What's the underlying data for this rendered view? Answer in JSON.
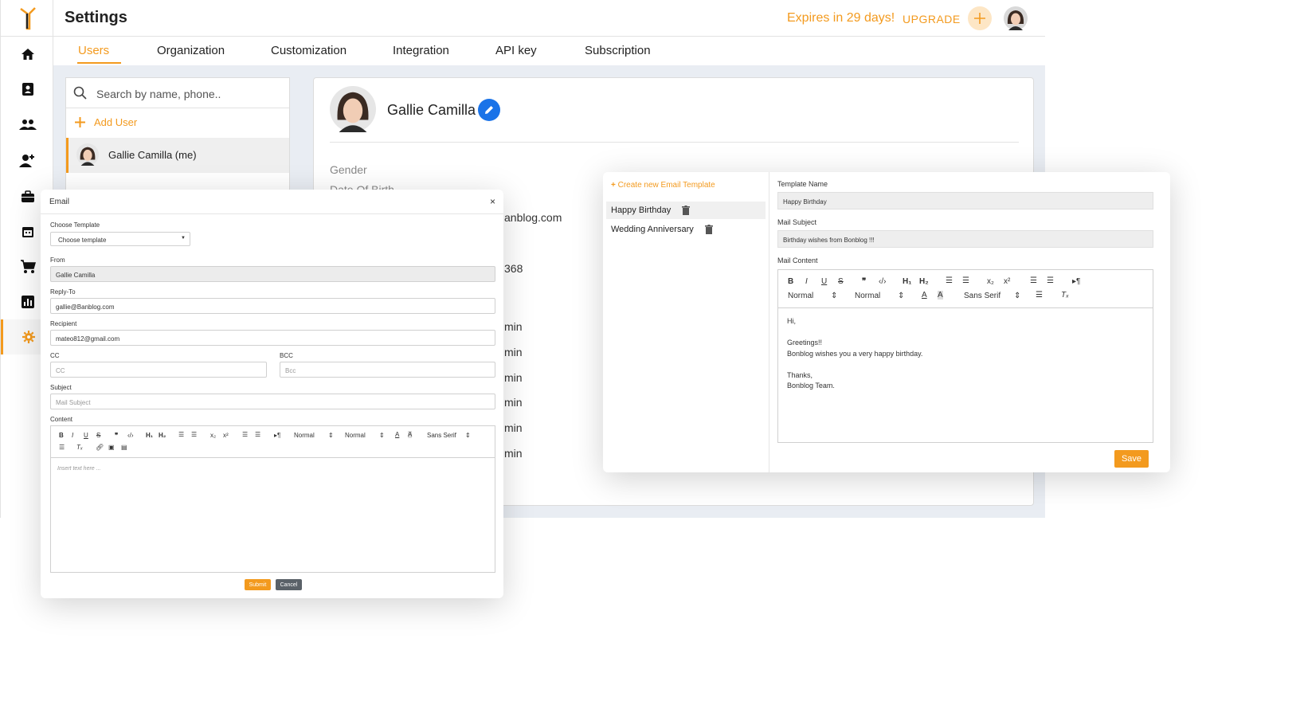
{
  "app": {
    "title": "Settings",
    "expires": "Expires in 29 days!",
    "upgrade": "UPGRADE",
    "accent_color": "#f39a1e",
    "tabs": [
      "Users",
      "Organization",
      "Customization",
      "Integration",
      "API key",
      "Subscription"
    ],
    "active_tab": "Users",
    "sidebar_icons": [
      "home-icon",
      "contacts-icon",
      "users-icon",
      "add-user-icon",
      "briefcase-icon",
      "calendar-icon",
      "cart-icon",
      "chart-icon",
      "gear-icon"
    ]
  },
  "users": {
    "search_placeholder": "Search by name, phone..",
    "add_user": "Add User",
    "list": [
      {
        "name": "Gallie Camilla (me)"
      }
    ]
  },
  "profile": {
    "name": "Gallie Camilla",
    "labels": {
      "gender": "Gender",
      "dob": "Date Of Birth"
    },
    "visible_fragments": {
      "email_tail": "anblog.com",
      "phone_tail": "368",
      "min": "min"
    }
  },
  "email_modal": {
    "title": "Email",
    "close": "×",
    "choose_template_label": "Choose Template",
    "choose_template_value": "Choose template",
    "from_label": "From",
    "from_value": "Gallie Camilla",
    "reply_to_label": "Reply-To",
    "reply_to_value": "gallie@Banblog.com",
    "recipient_label": "Recipient",
    "recipient_value": "mateo812@gmail.com",
    "cc_label": "CC",
    "cc_placeholder": "CC",
    "bcc_label": "BCC",
    "bcc_placeholder": "Bcc",
    "subject_label": "Subject",
    "subject_placeholder": "Mail Subject",
    "content_label": "Content",
    "toolbar": {
      "normal1": "Normal",
      "normal2": "Normal",
      "font": "Sans Serif"
    },
    "content_placeholder": "Insert text here ...",
    "submit": "Submit",
    "cancel": "Cancel"
  },
  "template_panel": {
    "create": "Create new Email Template",
    "templates": [
      "Happy Birthday",
      "Wedding Anniversary"
    ],
    "template_name_label": "Template Name",
    "template_name_value": "Happy Birthday",
    "mail_subject_label": "Mail Subject",
    "mail_subject_value": "Birthday wishes from Bonblog !!!",
    "mail_content_label": "Mail Content",
    "toolbar": {
      "normal1": "Normal",
      "normal2": "Normal",
      "font": "Sans Serif"
    },
    "body_lines": [
      "Hi,",
      "",
      "Greetings!!",
      "Bonblog wishes you a very happy birthday.",
      "",
      "Thanks,",
      "Bonblog Team."
    ],
    "save": "Save"
  }
}
